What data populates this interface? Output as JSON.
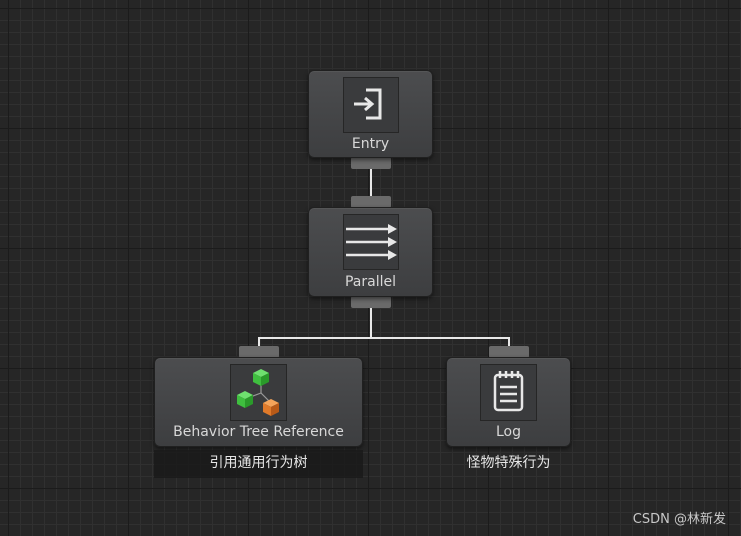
{
  "graph": {
    "nodes": {
      "entry": {
        "label": "Entry",
        "icon": "entry-icon"
      },
      "parallel": {
        "label": "Parallel",
        "icon": "parallel-arrows-icon"
      },
      "behavior_tree_reference": {
        "label": "Behavior Tree Reference",
        "icon": "behavior-tree-reference-icon",
        "comment": "引用通用行为树"
      },
      "log": {
        "label": "Log",
        "icon": "notepad-icon",
        "comment": "怪物特殊行为"
      }
    },
    "colors": {
      "background": "#262626",
      "node": "#46474a",
      "connection": "#e8e8e8",
      "cube_green": "#3fbf3f",
      "cube_orange": "#e07a2a"
    }
  },
  "watermark": "CSDN @林新发"
}
